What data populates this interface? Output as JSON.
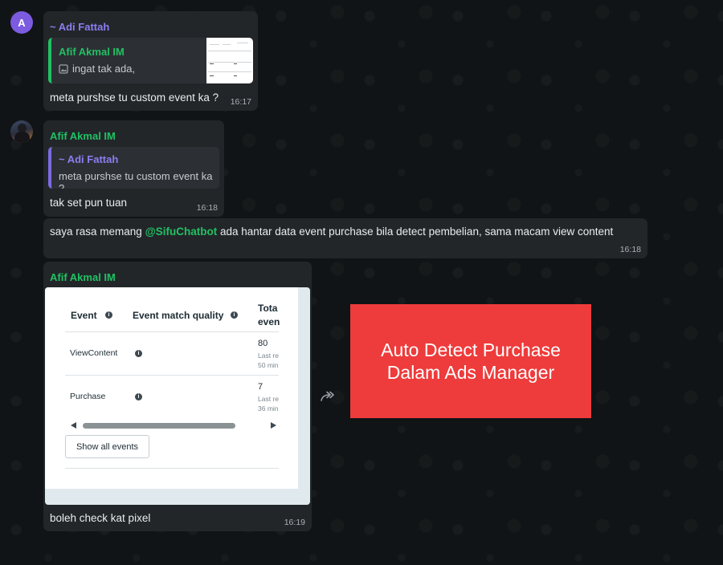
{
  "messages": {
    "m1": {
      "avatar_letter": "A",
      "sender": "~ Adi Fattah",
      "quote_sender": "Afif Akmal IM",
      "quote_text": "ingat tak ada,",
      "text": "meta purshse tu custom event ka ?",
      "time": "16:17"
    },
    "m2": {
      "sender": "Afif Akmal IM",
      "quote_sender": "~ Adi Fattah",
      "quote_text": "meta purshse tu custom event ka ?",
      "text": "tak set pun tuan",
      "time": "16:18"
    },
    "m3": {
      "text_before": "saya rasa memang ",
      "mention": "@SifuChatbot",
      "text_after": " ada hantar data event purchase bila detect pembelian, sama macam view content",
      "time": "16:18"
    },
    "m4": {
      "sender": "Afif Akmal IM",
      "text": "boleh check kat pixel",
      "time": "16:19",
      "screenshot": {
        "headers": [
          "Event",
          "Event match quality",
          "Tota",
          "even"
        ],
        "rows": [
          {
            "event": "ViewContent",
            "count": "80",
            "sub1": "Last re",
            "sub2": "50 min"
          },
          {
            "event": "Purchase",
            "count": "7",
            "sub1": "Last re",
            "sub2": "36 min"
          }
        ],
        "button": "Show all events"
      }
    }
  },
  "promo": {
    "line1": "Auto Detect Purchase",
    "line2": "Dalam Ads Manager"
  },
  "icons": {
    "forward": "forward-icon",
    "image": "image-icon",
    "info": "info-icon"
  },
  "colors": {
    "accent_green": "#21c063",
    "accent_purple": "#8e7cf0",
    "promo_red": "#ee3b3b"
  }
}
